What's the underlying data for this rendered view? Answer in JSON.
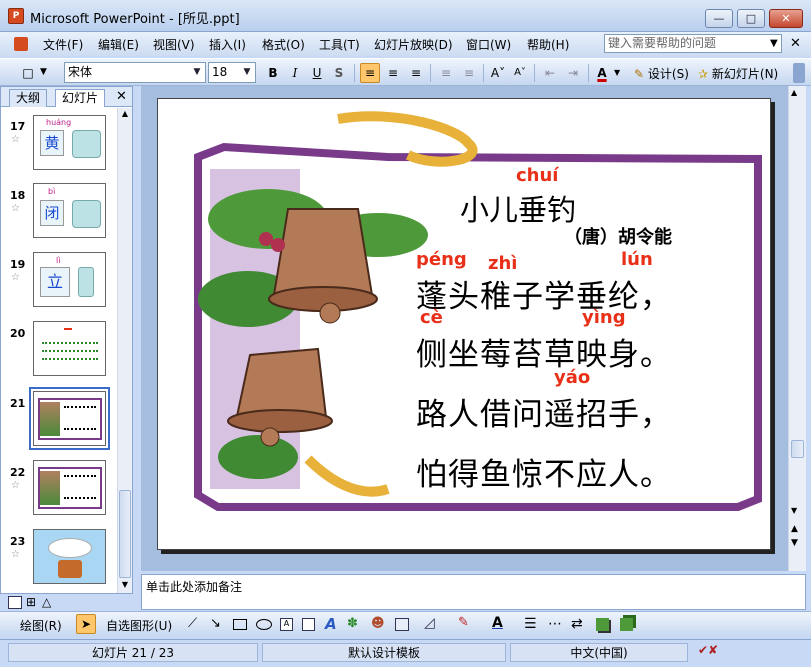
{
  "window": {
    "title": "Microsoft PowerPoint - [所见.ppt]",
    "app_icon": "P"
  },
  "menu": [
    "文件(F)",
    "编辑(E)",
    "视图(V)",
    "插入(I)",
    "格式(O)",
    "工具(T)",
    "幻灯片放映(D)",
    "窗口(W)",
    "帮助(H)"
  ],
  "help_placeholder": "键入需要帮助的问题",
  "toolbar": {
    "font": "宋体",
    "size": "18",
    "design": "设计(S)",
    "new_slide": "新幻灯片(N)"
  },
  "panel_tabs": [
    "大纲",
    "幻灯片"
  ],
  "thumbnails": [
    {
      "num": "17",
      "py": "huáng",
      "ch": "黄"
    },
    {
      "num": "18",
      "py": "bì",
      "ch": "闭"
    },
    {
      "num": "19",
      "py": "lì",
      "ch": "立"
    },
    {
      "num": "20"
    },
    {
      "num": "21"
    },
    {
      "num": "22"
    },
    {
      "num": "23"
    }
  ],
  "slide": {
    "title": "小儿垂钓",
    "author": "（唐）胡令能",
    "lines": [
      "蓬头稚子学垂纶，",
      "侧坐莓苔草映身。",
      "路人借问遥招手，",
      "怕得鱼惊不应人。"
    ],
    "pinyin": {
      "title": "chuí",
      "p1": "péng",
      "p2": "zhì",
      "p3": "lún",
      "p4": "cè",
      "p5": "yìng",
      "p6": "yáo"
    }
  },
  "notes_placeholder": "单击此处添加备注",
  "drawbar": {
    "draw": "绘图(R)",
    "autoshapes": "自选图形(U)"
  },
  "status": {
    "slide": "幻灯片 21 / 23",
    "template": "默认设计模板",
    "lang": "中文(中国)"
  },
  "colors": {
    "pinyin": "#e83018",
    "frame": "#7a3a8a",
    "selection": "#3a6ec6"
  }
}
